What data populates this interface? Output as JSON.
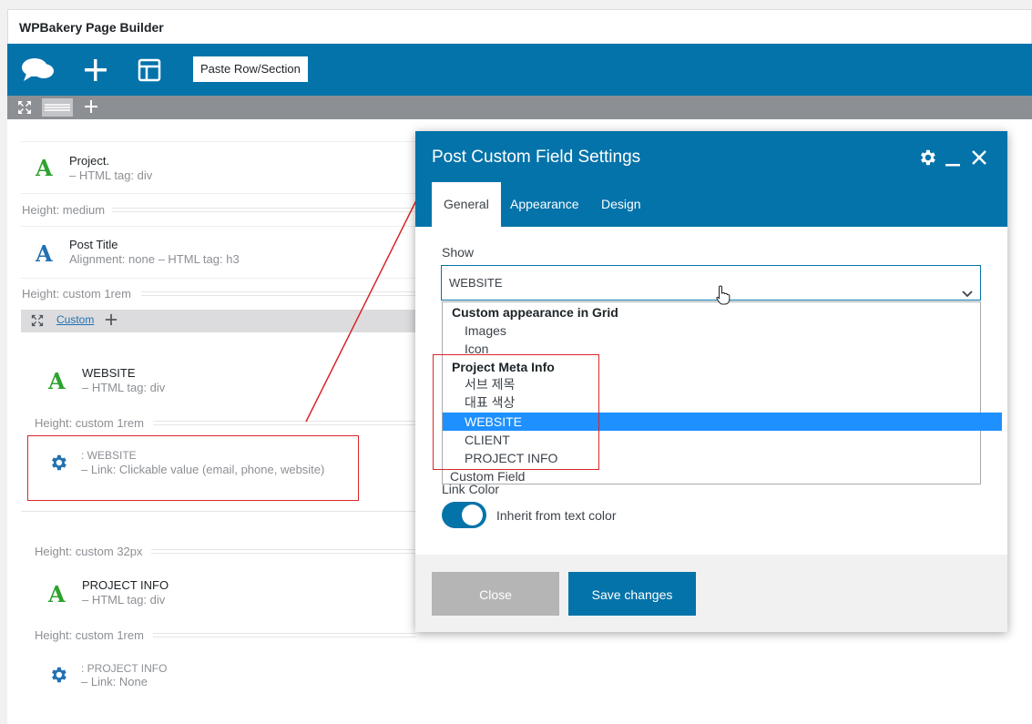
{
  "app": {
    "title": "WPBakery Page Builder"
  },
  "toolbar": {
    "paste_label": "Paste Row/Section",
    "icons": [
      "chat-icon",
      "plus-icon",
      "layout-icon"
    ]
  },
  "rowbar": {
    "icons": [
      "expand-icon",
      "drag-handle-icon",
      "plus-icon"
    ]
  },
  "canvas": {
    "elements": [
      {
        "title": "Project.",
        "subtitle": "– HTML tag: div",
        "icon": "text-block-icon",
        "color": "#2ea32e"
      },
      {
        "title": "Post Title",
        "subtitle": "Alignment: none  –  HTML tag: h3",
        "icon": "text-block-icon",
        "color": "#2271b1"
      },
      {
        "title": "WEBSITE",
        "subtitle": "– HTML tag: div",
        "icon": "text-block-icon",
        "color": "#2ea32e"
      },
      {
        "title": ": WEBSITE",
        "subtitle": "– Link: Clickable value (email, phone, website)",
        "icon": "gear-icon",
        "color": "#2271b1"
      },
      {
        "title": "PROJECT INFO",
        "subtitle": "– HTML tag: div",
        "icon": "text-block-icon",
        "color": "#2ea32e"
      },
      {
        "title": ": PROJECT INFO",
        "subtitle": "– Link: None",
        "icon": "gear-icon",
        "color": "#2271b1"
      }
    ],
    "heights": [
      "Height: medium",
      "Height: custom  1rem",
      "Height: custom  1rem",
      "Height: custom  32px",
      "Height: custom  1rem"
    ],
    "inner_row": {
      "label": "Custom"
    }
  },
  "modal": {
    "title": "Post Custom Field Settings",
    "tabs": [
      "General",
      "Appearance",
      "Design"
    ],
    "active_tab": "General",
    "show_label": "Show",
    "show_value": "WEBSITE",
    "options": [
      {
        "label": "Custom appearance in Grid",
        "kind": "group"
      },
      {
        "label": "Images",
        "kind": "item"
      },
      {
        "label": "Icon",
        "kind": "item"
      },
      {
        "label": "Project Meta Info",
        "kind": "group"
      },
      {
        "label": "서브 제목",
        "kind": "item"
      },
      {
        "label": "대표 색상",
        "kind": "item"
      },
      {
        "label": "WEBSITE",
        "kind": "item",
        "selected": true
      },
      {
        "label": "CLIENT",
        "kind": "item"
      },
      {
        "label": "PROJECT INFO",
        "kind": "item"
      },
      {
        "label": "Custom Field",
        "kind": "plain"
      }
    ],
    "link_color_label": "Link Color",
    "toggle_label": "Inherit from text color",
    "toggle_on": true,
    "close_label": "Close",
    "save_label": "Save changes",
    "accent": "#0473aa",
    "highlight": "#d9262b"
  }
}
